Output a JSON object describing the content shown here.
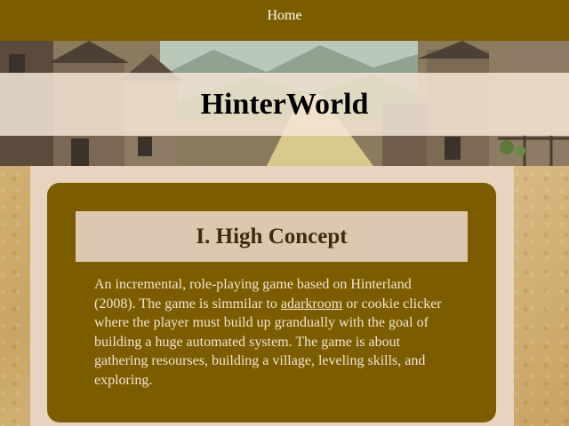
{
  "nav": {
    "home_label": "Home"
  },
  "banner": {
    "title": "HinterWorld"
  },
  "section": {
    "heading": "I. High Concept",
    "body_before_link": "An incremental, role-playing game based on Hinterland (2008). The game is simmilar to ",
    "link_text": "adarkroom",
    "body_after_link": " or cookie clicker where the player must build up grandually with the goal of building a huge automated system. The game is about gathering resourses, building a village, leveling skills, and exploring."
  },
  "colors": {
    "nav_bg": "#7b5d00",
    "card_bg": "#7b5d00",
    "frame_bg": "#e7d3bf",
    "heading_bg": "#dcc7b1",
    "body_text": "#f2e4d0"
  }
}
